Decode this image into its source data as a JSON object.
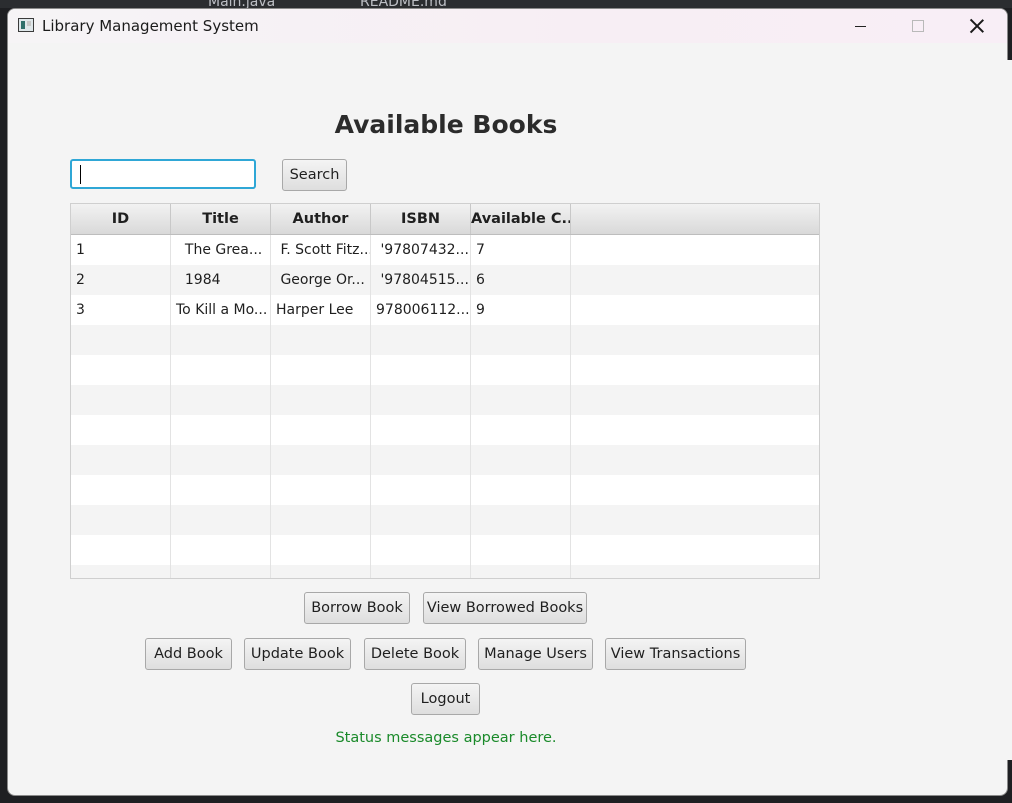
{
  "background": {
    "tab1": "Main.java",
    "tab2": "README.md"
  },
  "window": {
    "title": "Library Management System"
  },
  "heading": "Available Books",
  "search": {
    "value": "",
    "button_label": "Search"
  },
  "table": {
    "columns": [
      "ID",
      "Title",
      "Author",
      "ISBN",
      "Available C..."
    ],
    "rows": [
      [
        "1",
        "  The Grea...",
        " F. Scott Fitz...",
        " '97807432...",
        "7"
      ],
      [
        "2",
        "  1984",
        " George Or...",
        " '97804515...",
        "6"
      ],
      [
        "3",
        "To Kill a Mo...",
        "Harper Lee",
        "978006112...",
        "9"
      ]
    ],
    "empty_rows": 9
  },
  "actions": {
    "borrow": "Borrow Book",
    "view_borrowed": "View Borrowed Books",
    "add": "Add Book",
    "update": "Update Book",
    "delete": "Delete Book",
    "manage_users": "Manage Users",
    "view_transactions": "View Transactions",
    "logout": "Logout"
  },
  "status_message": "Status messages appear here.",
  "colors": {
    "focus_border": "#2fa7d6",
    "status_text": "#1a8a2a"
  }
}
